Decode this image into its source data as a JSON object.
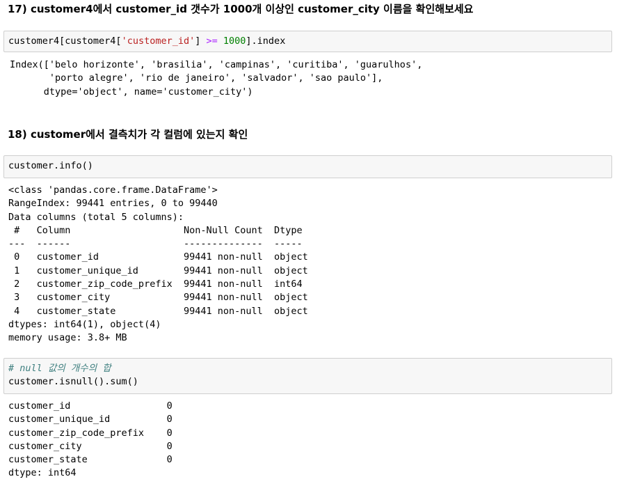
{
  "section17": {
    "title": "17) customer4에서 customer_id 갯수가 1000개 이상인 customer_city 이름을 확인해보세요",
    "code": {
      "part1": "customer4[customer4[",
      "string": "'customer_id'",
      "part2": "] ",
      "operator": ">=",
      "space": " ",
      "number": "1000",
      "part3": "].index"
    },
    "output": "Index(['belo horizonte', 'brasilia', 'campinas', 'curitiba', 'guarulhos',\n       'porto alegre', 'rio de janeiro', 'salvador', 'sao paulo'],\n      dtype='object', name='customer_city')"
  },
  "section18": {
    "title": "18) customer에서 결측치가 각 컬럼에 있는지 확인",
    "code_info": "customer.info()",
    "output_info": "<class 'pandas.core.frame.DataFrame'>\nRangeIndex: 99441 entries, 0 to 99440\nData columns (total 5 columns):\n #   Column                    Non-Null Count  Dtype \n---  ------                    --------------  ----- \n 0   customer_id               99441 non-null  object\n 1   customer_unique_id        99441 non-null  object\n 2   customer_zip_code_prefix  99441 non-null  int64 \n 3   customer_city             99441 non-null  object\n 4   customer_state            99441 non-null  object\ndtypes: int64(1), object(4)\nmemory usage: 3.8+ MB",
    "code_isnull_comment": "# null 값의 개수의 합",
    "code_isnull": "customer.isnull().sum()",
    "output_isnull": "customer_id                 0\ncustomer_unique_id          0\ncustomer_zip_code_prefix    0\ncustomer_city               0\ncustomer_state              0\ndtype: int64"
  }
}
